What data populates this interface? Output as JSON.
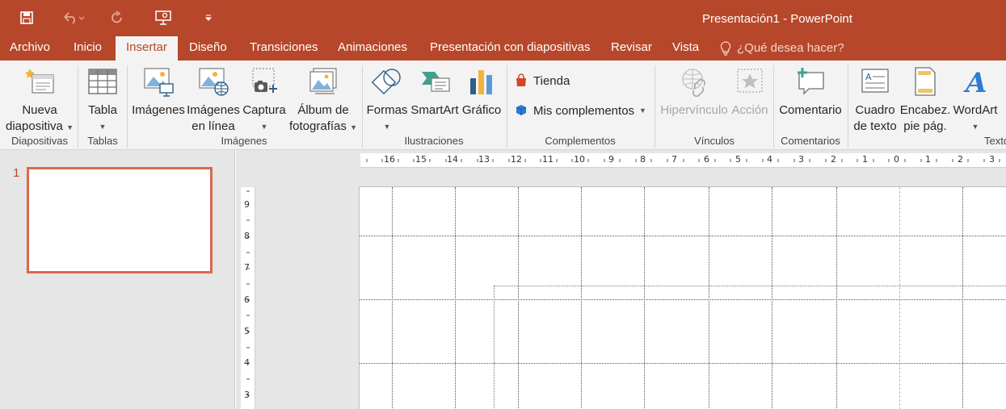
{
  "window": {
    "title": "Presentación1 - PowerPoint",
    "accent": "#b7472a"
  },
  "qat": {
    "icons": [
      "save-icon",
      "undo-icon",
      "redo-icon",
      "present-icon",
      "customize-icon"
    ]
  },
  "tabs": [
    {
      "label": "Archivo"
    },
    {
      "label": "Inicio"
    },
    {
      "label": "Insertar",
      "active": true
    },
    {
      "label": "Diseño"
    },
    {
      "label": "Transiciones"
    },
    {
      "label": "Animaciones"
    },
    {
      "label": "Presentación con diapositivas"
    },
    {
      "label": "Revisar"
    },
    {
      "label": "Vista"
    }
  ],
  "tell_me": "¿Qué desea hacer?",
  "ribbon": {
    "groups": {
      "diapositivas": "Diapositivas",
      "tablas": "Tablas",
      "imagenes": "Imágenes",
      "ilustraciones": "Ilustraciones",
      "complementos": "Complementos",
      "vinculos": "Vínculos",
      "comentarios": "Comentarios",
      "texto": "Texto"
    },
    "buttons": {
      "nueva_1": "Nueva",
      "nueva_2": "diapositiva",
      "tabla": "Tabla",
      "imagenes": "Imágenes",
      "imagenes_linea_1": "Imágenes",
      "imagenes_linea_2": "en línea",
      "captura": "Captura",
      "album_1": "Álbum de",
      "album_2": "fotografías",
      "formas": "Formas",
      "smartart": "SmartArt",
      "grafico": "Gráfico",
      "tienda": "Tienda",
      "mis_complementos": "Mis complementos",
      "hipervinculo": "Hipervínculo",
      "accion": "Acción",
      "comentario": "Comentario",
      "cuadro_1": "Cuadro",
      "cuadro_2": "de texto",
      "encabez_1": "Encabez.",
      "encabez_2": "pie pág.",
      "wordart": "WordArt"
    }
  },
  "slides": [
    {
      "number": "1"
    }
  ],
  "ruler_h": [
    "16",
    "15",
    "14",
    "13",
    "12",
    "11",
    "10",
    "9",
    "8",
    "7",
    "6",
    "5",
    "4",
    "3",
    "2",
    "1",
    "0",
    "1",
    "2",
    "3"
  ],
  "ruler_v": [
    "9",
    "8",
    "7",
    "6",
    "5",
    "4",
    "3"
  ]
}
